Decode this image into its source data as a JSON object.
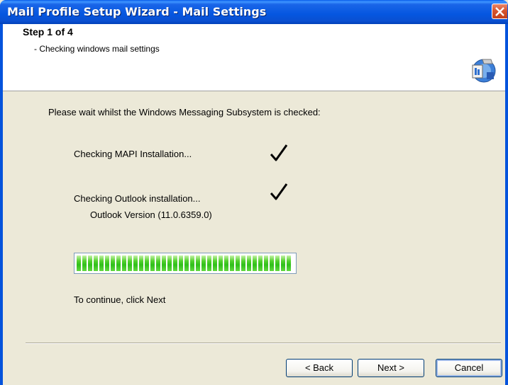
{
  "window": {
    "title": "Mail Profile Setup Wizard - Mail Settings"
  },
  "header": {
    "step_title": "Step 1 of 4",
    "step_subtitle": "- Checking windows mail settings",
    "icon": "mail-setup-icon"
  },
  "body": {
    "intro": "Please wait whilst the Windows Messaging Subsystem is checked:",
    "checks": [
      {
        "label": "Checking MAPI Installation...",
        "status": "done"
      },
      {
        "label": "Checking Outlook installation...",
        "status": "done"
      }
    ],
    "outlook_version": "Outlook Version (11.0.6359.0)",
    "progress_percent": 100,
    "continue_text": "To continue, click Next"
  },
  "buttons": {
    "back": "< Back",
    "next": "Next >",
    "cancel": "Cancel"
  },
  "colors": {
    "title_bar": "#0553DC",
    "progress": "#2FBF1A",
    "close_button": "#D7552E"
  }
}
